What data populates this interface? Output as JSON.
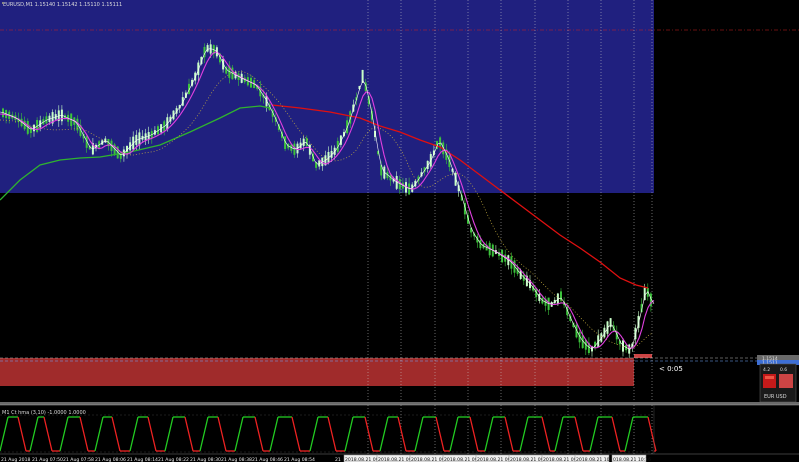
{
  "chart": {
    "header": "EURUSD,M1  1.15140 1.15142 1.15110 1.15111",
    "countdown": "< 0:05",
    "price_tags": [
      "1.1514",
      "1.1511"
    ],
    "indicator_label": "M1 Ct hma (3,10) -1.0000 1.0000",
    "widget": {
      "values": [
        "4.2",
        "0.6"
      ],
      "label": "EUR USD"
    },
    "time_labels": [
      "21 Aug 2018",
      "21 Aug 07:50",
      "21 Aug 07:58",
      "21 Aug 08:06",
      "21 Aug 08:14",
      "21 Aug 08:22",
      "21 Aug 08:30",
      "21 Aug 08:38",
      "21 Aug 08:46",
      "21 Aug 08:54",
      "21",
      "2018.08.21 09:",
      "2018.08.21 09:17",
      "2018.08.21 09:28",
      "2018.08.21 09:",
      "2018.08.21 09:41",
      "2018.08.21 09:",
      "2018.08.21 09:57",
      "2018.08.21 10:07",
      "018.08.21 10:16"
    ],
    "colors": {
      "zone_blue": "#20207f",
      "zone_red": "#a02b2b",
      "ma_red": "#e01010",
      "ma_green": "#2fb32f",
      "ma_magenta": "#e040e0",
      "candle_up": "#c8ffc8",
      "candle_down": "#3cc43c",
      "ind_green": "#22cc22",
      "ind_red": "#ee2222"
    }
  }
}
